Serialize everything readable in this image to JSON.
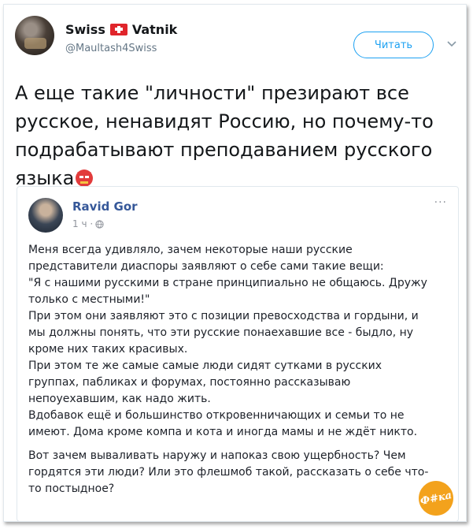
{
  "tweet": {
    "author_name_left": "Swiss",
    "author_name_right": "Vatnik",
    "handle": "@Maultash4Swiss",
    "follow_label": "Читать",
    "text": "А еще такие \"личности\" презирают все русское, ненавидят Россию, но почему-то подрабатывают преподаванием русского языка"
  },
  "quoted_post": {
    "author": "Ravid Gor",
    "time": "1 ч ·",
    "more": "···",
    "paragraph1": [
      "Меня всегда удивляло, зачем некоторые наши русские",
      "представители диаспоры заявляют о себе сами такие вещи:",
      "\"Я с нашими русскими в стране принципиально не общаюсь. Дружу",
      "только с местными!\"",
      "При этом они заявляют это с позиции превосходства и гордыни, и",
      "мы должны понять, что эти русские понаехавшие все - быдло, ну",
      "кроме них таких красивых.",
      "При этом те же самые самые люди сидят сутками в русских",
      "группах, пабликах и форумах, постоянно рассказываю",
      "непоуехавшим, как надо жить.",
      "Вдобавок ещё и большинство откровенничающих и семьи то не",
      "имеют. Дома кроме компа и кота и иногда мамы и не ждёт никто."
    ],
    "paragraph2": [
      "Вот зачем вываливать наружу и напоказ свою ущербность? Чем",
      "гордятся эти люди? Или это флешмоб такой, рассказать о себе что-",
      "то постыдное?"
    ]
  },
  "watermark": "Ф#ка",
  "colors": {
    "follow": "#1da1f2",
    "fb_name": "#365899",
    "flag": "#e0252b",
    "watermark": "#f3a21c"
  }
}
